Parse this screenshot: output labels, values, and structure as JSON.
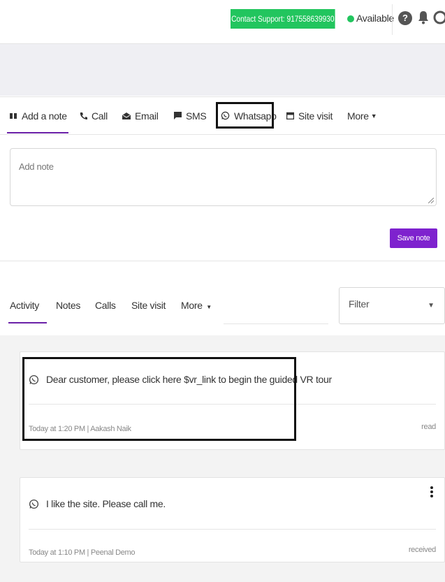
{
  "topbar": {
    "support_label": "Contact Support: 917558639930",
    "availability": "Available",
    "help_glyph": "?",
    "colors": {
      "support_bg": "#22c55e",
      "available_dot": "#22c55e"
    },
    "icons": [
      "help-icon",
      "bell-icon",
      "user-icon"
    ]
  },
  "composer": {
    "tabs": [
      {
        "label": "Add a note",
        "icon": "quote-icon"
      },
      {
        "label": "Call",
        "icon": "phone-icon"
      },
      {
        "label": "Email",
        "icon": "envelope-icon"
      },
      {
        "label": "SMS",
        "icon": "chat-bubble-icon"
      },
      {
        "label": "Whatsapp",
        "icon": "whatsapp-icon"
      },
      {
        "label": "Site visit",
        "icon": "calendar-icon"
      },
      {
        "label": "More",
        "icon": "caret-down-icon"
      }
    ],
    "active_tab": "Add a note",
    "note_placeholder": "Add note",
    "save_label": "Save note",
    "accent": "#7e22ce"
  },
  "activity": {
    "tabs": [
      "Activity",
      "Notes",
      "Calls",
      "Site visit",
      "More"
    ],
    "active_tab": "Activity",
    "filter_label": "Filter",
    "items": [
      {
        "message": "Dear customer, please click here $vr_link to begin the guided VR tour",
        "meta": "Today at 1:20 PM  |  Aakash Naik",
        "status": "read",
        "icon": "whatsapp-icon"
      },
      {
        "message": "I like the site. Please call me.",
        "meta": "Today at 1:10 PM  |  Peenal Demo",
        "status": "received",
        "icon": "whatsapp-icon"
      }
    ]
  }
}
